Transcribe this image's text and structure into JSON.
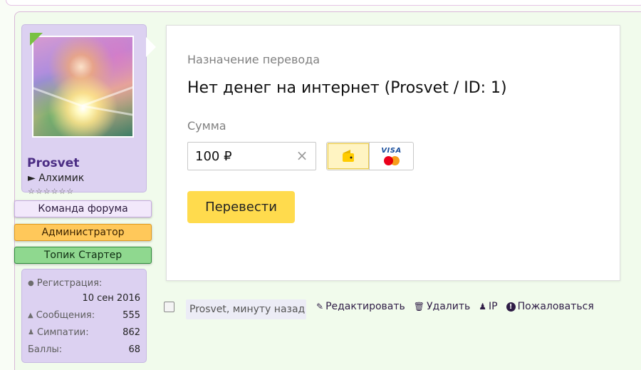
{
  "user": {
    "name": "Prosvet",
    "title": "► Алхимик",
    "stars": "☆☆☆☆☆☆",
    "banners": [
      "Команда форума",
      "Администратор",
      "Топик Стартер"
    ],
    "stats": {
      "reg_label": "Регистрация:",
      "reg_value": "10 сен 2016",
      "posts_label": "Сообщения:",
      "posts_value": "555",
      "likes_label": "Симпатии:",
      "likes_value": "862",
      "points_label": "Баллы:",
      "points_value": "68"
    }
  },
  "payment_widget": {
    "purpose_label": "Назначение перевода",
    "purpose_text": "Нет денег на интернет (Prosvet / ID: 1)",
    "sum_label": "Сумма",
    "amount_value": "100 ₽",
    "card_brand": "VISA",
    "submit_label": "Перевести",
    "accent_color": "#ffdb4d"
  },
  "post_meta": {
    "author": "Prosvet",
    "time": ", минуту назад",
    "actions": {
      "edit": "Редактировать",
      "delete": "Удалить",
      "ip": "IP",
      "report": "Пожаловаться"
    }
  }
}
